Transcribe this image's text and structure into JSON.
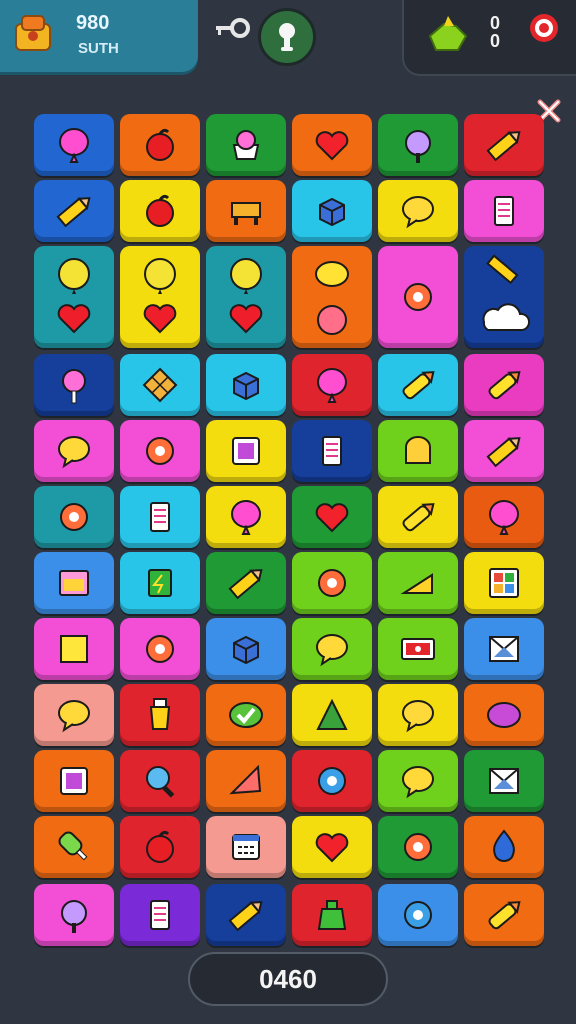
{
  "hud": {
    "score": "980",
    "label": "SUTH",
    "right_value": "0\n0",
    "bottom_score": "0460"
  },
  "colors": {
    "blue": "#2166d1",
    "orange": "#f16b12",
    "green": "#1f9a35",
    "red": "#e0242d",
    "yellow": "#f4dd0e",
    "cyan": "#28c5e8",
    "teal": "#1e9aa6",
    "pink": "#f24fd6",
    "navy": "#153f9b",
    "lime": "#70d11d",
    "salmon": "#f49a90",
    "purple": "#7a2ad6",
    "skyblue": "#3b8fe8",
    "darkorange": "#e85b10",
    "magenta": "#ea3cc0"
  },
  "rows": [
    [
      {
        "color": "blue",
        "icon": "balloon-icon"
      },
      {
        "color": "orange",
        "icon": "apple-icon"
      },
      {
        "color": "green",
        "icon": "cupcake-icon"
      },
      {
        "color": "orange",
        "icon": "heart-icon"
      },
      {
        "color": "green",
        "icon": "candy-icon"
      },
      {
        "color": "red",
        "icon": "pencil-icon"
      }
    ],
    [
      {
        "color": "blue",
        "icon": "pencil-icon"
      },
      {
        "color": "yellow",
        "icon": "apple-icon"
      },
      {
        "color": "orange",
        "icon": "bench-icon"
      },
      {
        "color": "cyan",
        "icon": "box-icon"
      },
      {
        "color": "yellow",
        "icon": "speech-icon"
      },
      {
        "color": "pink",
        "icon": "note-icon"
      }
    ],
    [
      {
        "color": "teal",
        "icon": "balloon-heart-icon",
        "tall": true
      },
      {
        "color": "yellow",
        "icon": "balloon-heart-icon",
        "tall": true
      },
      {
        "color": "teal",
        "icon": "balloon-heart-icon",
        "tall": true
      },
      {
        "color": "orange",
        "icon": "lemon-icon",
        "tall": true
      },
      {
        "color": "pink",
        "icon": "flower-icon",
        "tall": true
      },
      {
        "color": "navy",
        "icon": "pencil-cloud-icon",
        "tall": true
      }
    ],
    [
      {
        "color": "navy",
        "icon": "lollipop-icon"
      },
      {
        "color": "cyan",
        "icon": "waffle-icon"
      },
      {
        "color": "cyan",
        "icon": "box-icon"
      },
      {
        "color": "red",
        "icon": "balloon-icon"
      },
      {
        "color": "cyan",
        "icon": "crayon-icon"
      },
      {
        "color": "magenta",
        "icon": "crayon-icon"
      }
    ],
    [
      {
        "color": "pink",
        "icon": "speech-icon"
      },
      {
        "color": "pink",
        "icon": "flower-icon"
      },
      {
        "color": "yellow",
        "icon": "frame-icon"
      },
      {
        "color": "navy",
        "icon": "note-icon"
      },
      {
        "color": "lime",
        "icon": "toast-icon"
      },
      {
        "color": "pink",
        "icon": "pencil-icon"
      }
    ],
    [
      {
        "color": "teal",
        "icon": "flower-icon"
      },
      {
        "color": "cyan",
        "icon": "note-icon"
      },
      {
        "color": "yellow",
        "icon": "balloon-icon"
      },
      {
        "color": "green",
        "icon": "heart-icon"
      },
      {
        "color": "yellow",
        "icon": "crayon-icon"
      },
      {
        "color": "darkorange",
        "icon": "balloon-icon"
      }
    ],
    [
      {
        "color": "skyblue",
        "icon": "window-icon"
      },
      {
        "color": "cyan",
        "icon": "card-icon"
      },
      {
        "color": "green",
        "icon": "pencil-icon"
      },
      {
        "color": "lime",
        "icon": "flower-icon"
      },
      {
        "color": "lime",
        "icon": "cheese-icon"
      },
      {
        "color": "yellow",
        "icon": "grid-icon"
      }
    ],
    [
      {
        "color": "pink",
        "icon": "sticky-note-icon"
      },
      {
        "color": "pink",
        "icon": "flower-icon"
      },
      {
        "color": "skyblue",
        "icon": "box-icon"
      },
      {
        "color": "lime",
        "icon": "speech-icon"
      },
      {
        "color": "lime",
        "icon": "ticket-icon"
      },
      {
        "color": "skyblue",
        "icon": "envelope-icon"
      }
    ],
    [
      {
        "color": "salmon",
        "icon": "speech-icon"
      },
      {
        "color": "red",
        "icon": "bottle-icon"
      },
      {
        "color": "orange",
        "icon": "check-icon"
      },
      {
        "color": "yellow",
        "icon": "triangle-icon"
      },
      {
        "color": "yellow",
        "icon": "speech-icon"
      },
      {
        "color": "orange",
        "icon": "blob-icon"
      }
    ],
    [
      {
        "color": "orange",
        "icon": "frame-icon"
      },
      {
        "color": "red",
        "icon": "magnifier-icon"
      },
      {
        "color": "orange",
        "icon": "pizza-icon"
      },
      {
        "color": "red",
        "icon": "gear-icon"
      },
      {
        "color": "lime",
        "icon": "speech-icon"
      },
      {
        "color": "green",
        "icon": "envelope-icon"
      }
    ],
    [
      {
        "color": "orange",
        "icon": "popsicle-icon"
      },
      {
        "color": "red",
        "icon": "apple-icon"
      },
      {
        "color": "salmon",
        "icon": "calendar-icon"
      },
      {
        "color": "yellow",
        "icon": "heart-icon"
      },
      {
        "color": "green",
        "icon": "flower-icon"
      },
      {
        "color": "orange",
        "icon": "drop-icon"
      }
    ],
    [
      {
        "color": "pink",
        "icon": "candy-icon"
      },
      {
        "color": "purple",
        "icon": "note-icon"
      },
      {
        "color": "navy",
        "icon": "pencil-icon"
      },
      {
        "color": "red",
        "icon": "bag-icon"
      },
      {
        "color": "skyblue",
        "icon": "gear-icon"
      },
      {
        "color": "orange",
        "icon": "crayon-icon"
      }
    ]
  ]
}
